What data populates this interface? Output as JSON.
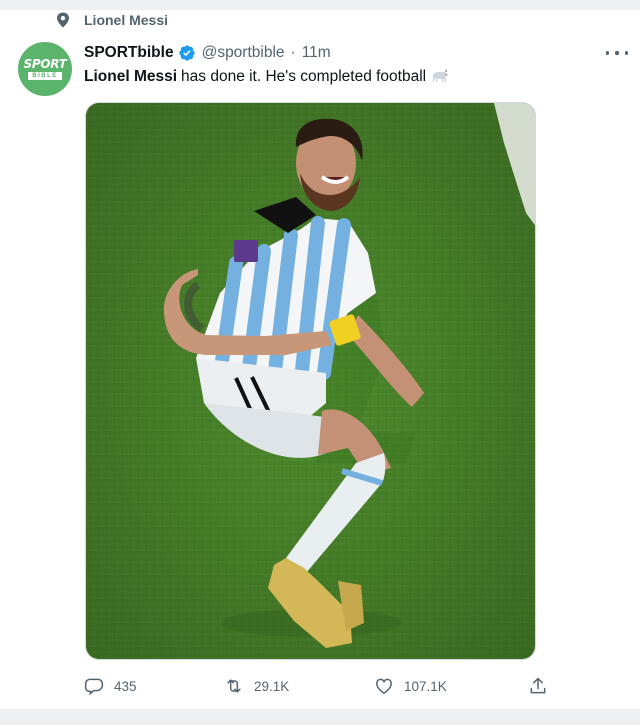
{
  "context": {
    "label": "Lionel Messi",
    "icon": "pin-icon"
  },
  "author": {
    "avatar_line1": "SPORT",
    "avatar_line2": "BIBLE",
    "name": "SPORTbible",
    "verified_icon": "verified-badge-icon",
    "handle": "@sportbible",
    "separator": "·",
    "time": "11m"
  },
  "tweet": {
    "mention": "Lionel Messi",
    "body": "has done it. He's completed football",
    "emoji_icon": "goat-icon"
  },
  "media": {
    "description_icon": "photo"
  },
  "actions": {
    "replies": "435",
    "retweets": "29.1K",
    "likes": "107.1K"
  },
  "colors": {
    "text_primary": "#0f1419",
    "text_secondary": "#536471",
    "verified": "#1d9bf0",
    "avatar": "#5bb46b",
    "pitch": "#4f8d2e"
  }
}
